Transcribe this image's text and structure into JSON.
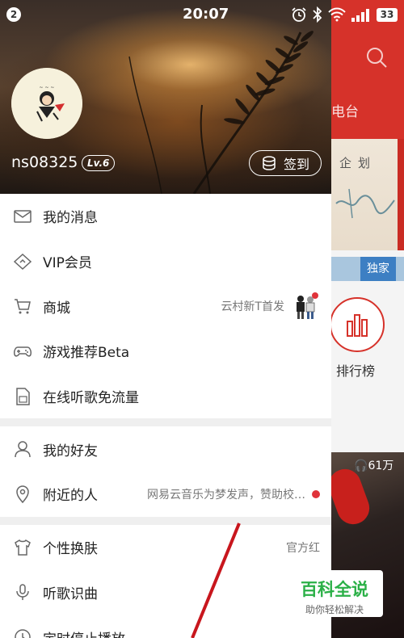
{
  "status_bar": {
    "notification_count": "2",
    "time": "20:07",
    "battery": "33"
  },
  "background_app": {
    "tab_partial": "电台",
    "banner_text": "企划",
    "badge_exclusive": "独家",
    "rank_label": "排行榜",
    "play_count": "61万"
  },
  "profile": {
    "username": "ns08325",
    "level": "Lv.6",
    "signin_label": "签到"
  },
  "menu": {
    "group1": [
      {
        "label": "我的消息",
        "icon": "mail-icon"
      },
      {
        "label": "VIP会员",
        "icon": "diamond-icon"
      },
      {
        "label": "商城",
        "icon": "cart-icon",
        "right_text": "云村新T首发"
      },
      {
        "label": "游戏推荐Beta",
        "icon": "gamepad-icon"
      },
      {
        "label": "在线听歌免流量",
        "icon": "sim-card-icon"
      }
    ],
    "group2": [
      {
        "label": "我的好友",
        "icon": "person-icon"
      },
      {
        "label": "附近的人",
        "icon": "location-icon",
        "right_text": "网易云音乐为梦发声，赞助校…"
      }
    ],
    "group3": [
      {
        "label": "个性换肤",
        "icon": "tshirt-icon",
        "right_text": "官方红"
      },
      {
        "label": "听歌识曲",
        "icon": "mic-icon"
      },
      {
        "label": "定时停止播放",
        "icon": "clock-icon"
      }
    ]
  },
  "watermark": {
    "main": "百科全说",
    "sub": "助你轻松解决"
  },
  "colors": {
    "brand_red": "#d6322a",
    "badge_red": "#e0333a",
    "watermark_green": "#2bb047"
  }
}
